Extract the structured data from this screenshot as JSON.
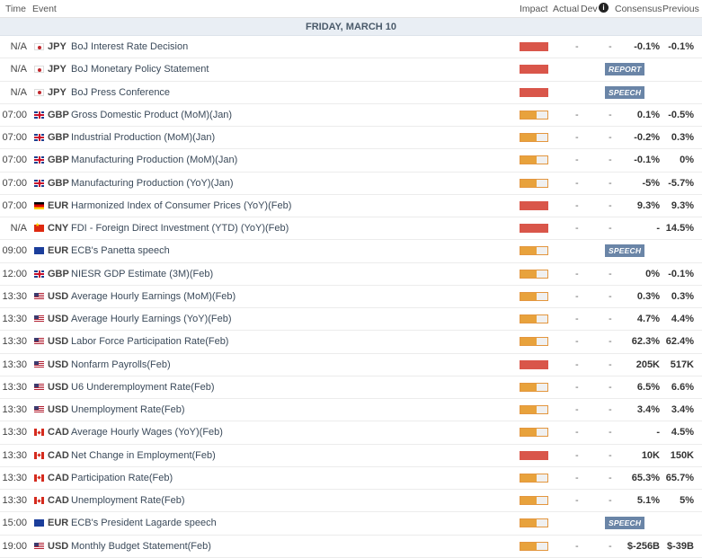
{
  "header": {
    "time": "Time",
    "event": "Event",
    "impact": "Impact",
    "actual": "Actual",
    "dev": "Dev",
    "consensus": "Consensus",
    "previous": "Previous"
  },
  "day_label": "FRIDAY, MARCH 10",
  "rows": [
    {
      "time": "N/A",
      "flag": "jp",
      "currency": "JPY",
      "event": "BoJ Interest Rate Decision",
      "impact": "high",
      "actual": "-",
      "dev": "-",
      "consensus": "-0.1%",
      "previous": "-0.1%",
      "badge": ""
    },
    {
      "time": "N/A",
      "flag": "jp",
      "currency": "JPY",
      "event": "BoJ Monetary Policy Statement",
      "impact": "high",
      "actual": "",
      "dev": "",
      "consensus": "",
      "previous": "",
      "badge": "REPORT"
    },
    {
      "time": "N/A",
      "flag": "jp",
      "currency": "JPY",
      "event": "BoJ Press Conference",
      "impact": "high",
      "actual": "",
      "dev": "",
      "consensus": "",
      "previous": "",
      "badge": "SPEECH"
    },
    {
      "time": "07:00",
      "flag": "gb",
      "currency": "GBP",
      "event": "Gross Domestic Product (MoM)(Jan)",
      "impact": "medium",
      "actual": "-",
      "dev": "-",
      "consensus": "0.1%",
      "previous": "-0.5%",
      "badge": ""
    },
    {
      "time": "07:00",
      "flag": "gb",
      "currency": "GBP",
      "event": "Industrial Production (MoM)(Jan)",
      "impact": "medium",
      "actual": "-",
      "dev": "-",
      "consensus": "-0.2%",
      "previous": "0.3%",
      "badge": ""
    },
    {
      "time": "07:00",
      "flag": "gb",
      "currency": "GBP",
      "event": "Manufacturing Production (MoM)(Jan)",
      "impact": "medium",
      "actual": "-",
      "dev": "-",
      "consensus": "-0.1%",
      "previous": "0%",
      "badge": ""
    },
    {
      "time": "07:00",
      "flag": "gb",
      "currency": "GBP",
      "event": "Manufacturing Production (YoY)(Jan)",
      "impact": "medium",
      "actual": "-",
      "dev": "-",
      "consensus": "-5%",
      "previous": "-5.7%",
      "badge": ""
    },
    {
      "time": "07:00",
      "flag": "de",
      "currency": "EUR",
      "event": "Harmonized Index of Consumer Prices (YoY)(Feb)",
      "impact": "high",
      "actual": "-",
      "dev": "-",
      "consensus": "9.3%",
      "previous": "9.3%",
      "badge": ""
    },
    {
      "time": "N/A",
      "flag": "cn",
      "currency": "CNY",
      "event": "FDI - Foreign Direct Investment (YTD) (YoY)(Feb)",
      "impact": "high",
      "actual": "-",
      "dev": "-",
      "consensus": "-",
      "previous": "14.5%",
      "badge": ""
    },
    {
      "time": "09:00",
      "flag": "eu",
      "currency": "EUR",
      "event": "ECB's Panetta speech",
      "impact": "medium",
      "actual": "",
      "dev": "",
      "consensus": "",
      "previous": "",
      "badge": "SPEECH"
    },
    {
      "time": "12:00",
      "flag": "gb",
      "currency": "GBP",
      "event": "NIESR GDP Estimate (3M)(Feb)",
      "impact": "medium",
      "actual": "-",
      "dev": "-",
      "consensus": "0%",
      "previous": "-0.1%",
      "badge": ""
    },
    {
      "time": "13:30",
      "flag": "us",
      "currency": "USD",
      "event": "Average Hourly Earnings (MoM)(Feb)",
      "impact": "medium",
      "actual": "-",
      "dev": "-",
      "consensus": "0.3%",
      "previous": "0.3%",
      "badge": ""
    },
    {
      "time": "13:30",
      "flag": "us",
      "currency": "USD",
      "event": "Average Hourly Earnings (YoY)(Feb)",
      "impact": "medium",
      "actual": "-",
      "dev": "-",
      "consensus": "4.7%",
      "previous": "4.4%",
      "badge": ""
    },
    {
      "time": "13:30",
      "flag": "us",
      "currency": "USD",
      "event": "Labor Force Participation Rate(Feb)",
      "impact": "medium",
      "actual": "-",
      "dev": "-",
      "consensus": "62.3%",
      "previous": "62.4%",
      "badge": ""
    },
    {
      "time": "13:30",
      "flag": "us",
      "currency": "USD",
      "event": "Nonfarm Payrolls(Feb)",
      "impact": "high",
      "actual": "-",
      "dev": "-",
      "consensus": "205K",
      "previous": "517K",
      "badge": ""
    },
    {
      "time": "13:30",
      "flag": "us",
      "currency": "USD",
      "event": "U6 Underemployment Rate(Feb)",
      "impact": "medium",
      "actual": "-",
      "dev": "-",
      "consensus": "6.5%",
      "previous": "6.6%",
      "badge": ""
    },
    {
      "time": "13:30",
      "flag": "us",
      "currency": "USD",
      "event": "Unemployment Rate(Feb)",
      "impact": "medium",
      "actual": "-",
      "dev": "-",
      "consensus": "3.4%",
      "previous": "3.4%",
      "badge": ""
    },
    {
      "time": "13:30",
      "flag": "ca",
      "currency": "CAD",
      "event": "Average Hourly Wages (YoY)(Feb)",
      "impact": "medium",
      "actual": "-",
      "dev": "-",
      "consensus": "-",
      "previous": "4.5%",
      "badge": ""
    },
    {
      "time": "13:30",
      "flag": "ca",
      "currency": "CAD",
      "event": "Net Change in Employment(Feb)",
      "impact": "high",
      "actual": "-",
      "dev": "-",
      "consensus": "10K",
      "previous": "150K",
      "badge": ""
    },
    {
      "time": "13:30",
      "flag": "ca",
      "currency": "CAD",
      "event": "Participation Rate(Feb)",
      "impact": "medium",
      "actual": "-",
      "dev": "-",
      "consensus": "65.3%",
      "previous": "65.7%",
      "badge": ""
    },
    {
      "time": "13:30",
      "flag": "ca",
      "currency": "CAD",
      "event": "Unemployment Rate(Feb)",
      "impact": "medium",
      "actual": "-",
      "dev": "-",
      "consensus": "5.1%",
      "previous": "5%",
      "badge": ""
    },
    {
      "time": "15:00",
      "flag": "eu",
      "currency": "EUR",
      "event": "ECB's President Lagarde speech",
      "impact": "medium",
      "actual": "",
      "dev": "",
      "consensus": "",
      "previous": "",
      "badge": "SPEECH"
    },
    {
      "time": "19:00",
      "flag": "us",
      "currency": "USD",
      "event": "Monthly Budget Statement(Feb)",
      "impact": "medium",
      "actual": "-",
      "dev": "-",
      "consensus": "$-256B",
      "previous": "$-39B",
      "badge": ""
    }
  ]
}
